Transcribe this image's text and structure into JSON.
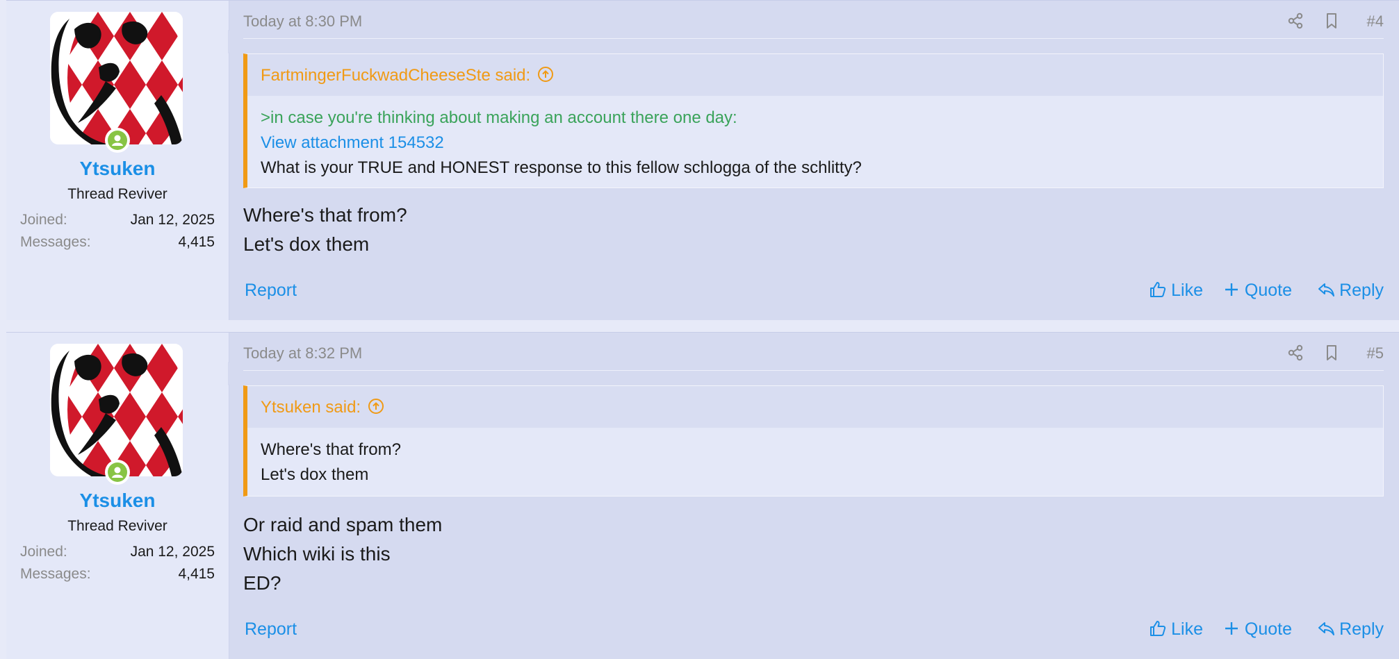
{
  "colors": {
    "accent": "#1b8fe6",
    "quote_accent": "#f09a15",
    "greentext": "#3aa35a",
    "online": "#88c444"
  },
  "posts": [
    {
      "user": {
        "name": "Ytsuken",
        "title": "Thread Reviver",
        "joined_label": "Joined:",
        "joined": "Jan 12, 2025",
        "messages_label": "Messages:",
        "messages": "4,415"
      },
      "date": "Today at 8:30 PM",
      "number": "#4",
      "quote": {
        "author": "FartmingerFuckwadCheeseSte said:",
        "lines": [
          {
            "text": ">in case you're thinking about making an account there one day:",
            "style": "greentext"
          },
          {
            "text": "View attachment 154532",
            "style": "link"
          },
          {
            "text": "What is your TRUE and HONEST response to this fellow schlogga of the schlitty?",
            "style": "plain"
          }
        ]
      },
      "body": [
        "Where's that from?",
        "Let's dox them"
      ],
      "actions": {
        "report": "Report",
        "like": "Like",
        "quote": "Quote",
        "reply": "Reply"
      }
    },
    {
      "user": {
        "name": "Ytsuken",
        "title": "Thread Reviver",
        "joined_label": "Joined:",
        "joined": "Jan 12, 2025",
        "messages_label": "Messages:",
        "messages": "4,415"
      },
      "date": "Today at 8:32 PM",
      "number": "#5",
      "quote": {
        "author": "Ytsuken said:",
        "lines": [
          {
            "text": "Where's that from?",
            "style": "plain"
          },
          {
            "text": "Let's dox them",
            "style": "plain"
          }
        ]
      },
      "body": [
        "Or raid and spam them",
        "Which wiki is this",
        "ED?"
      ],
      "actions": {
        "report": "Report",
        "like": "Like",
        "quote": "Quote",
        "reply": "Reply"
      }
    }
  ]
}
